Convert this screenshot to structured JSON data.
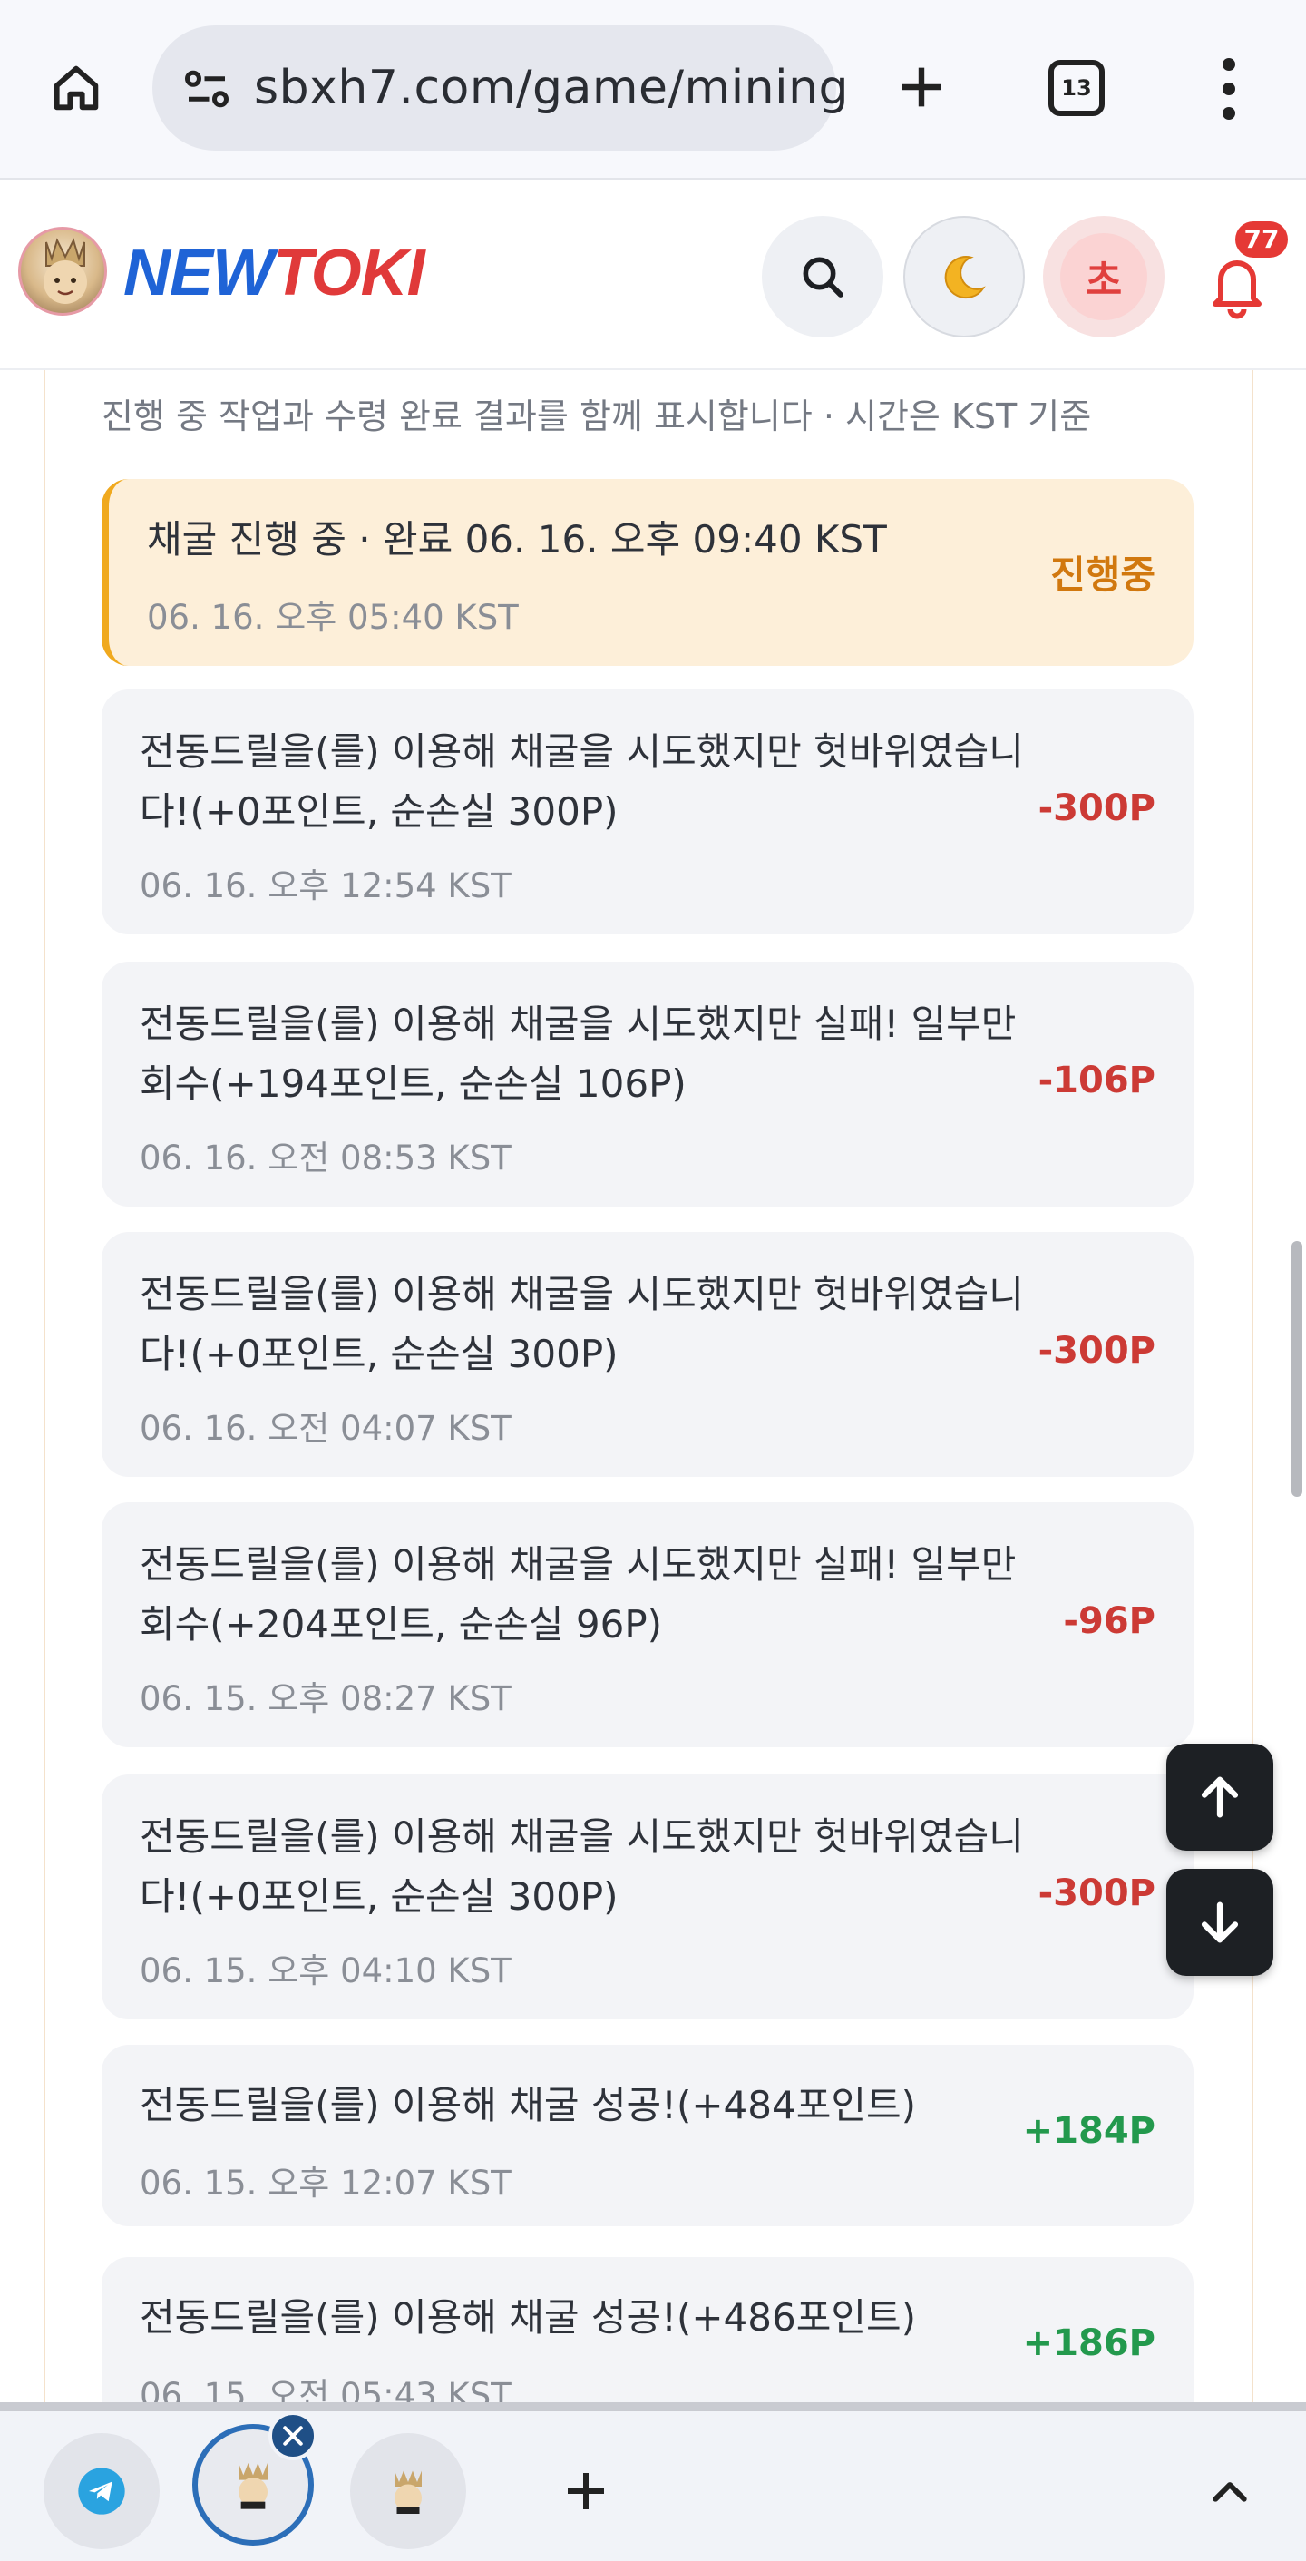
{
  "browser": {
    "url": "sbxh7.com/game/mining",
    "tab_count": "13",
    "icons": [
      "home-icon",
      "site-settings-icon",
      "plus-icon",
      "tabs-icon",
      "more-vert-icon"
    ]
  },
  "header": {
    "logo_new": "NEW",
    "logo_toki": "TOKI",
    "user_initial": "초",
    "notification_count": "77",
    "theme_icon": "moon-icon"
  },
  "content": {
    "subtitle": "진행 중 작업과 수령 완료 결과를 함께 표시합니다 · 시간은 KST 기준",
    "in_progress": {
      "text": "채굴 진행 중 · 완료 06. 16. 오후 09:40 KST",
      "time": "06. 16. 오후 05:40 KST",
      "status": "진행중"
    },
    "items": [
      {
        "text": "전동드릴을(를) 이용해 채굴을 시도했지만 헛바위였습니다!(+0포인트, 순손실 300P)",
        "time": "06. 16. 오후 12:54 KST",
        "amount": "-300P"
      },
      {
        "text": "전동드릴을(를) 이용해 채굴을 시도했지만 실패! 일부만 회수(+194포인트, 순손실 106P)",
        "time": "06. 16. 오전 08:53 KST",
        "amount": "-106P"
      },
      {
        "text": "전동드릴을(를) 이용해 채굴을 시도했지만 헛바위였습니다!(+0포인트, 순손실 300P)",
        "time": "06. 16. 오전 04:07 KST",
        "amount": "-300P"
      },
      {
        "text": "전동드릴을(를) 이용해 채굴을 시도했지만 실패! 일부만 회수(+204포인트, 순손실 96P)",
        "time": "06. 15. 오후 08:27 KST",
        "amount": "-96P"
      },
      {
        "text": "전동드릴을(를) 이용해 채굴을 시도했지만 헛바위였습니다!(+0포인트, 순손실 300P)",
        "time": "06. 15. 오후 04:10 KST",
        "amount": "-300P"
      },
      {
        "text": "전동드릴을(를) 이용해 채굴 성공!(+484포인트)",
        "time": "06. 15. 오후 12:07 KST",
        "amount": "+184P"
      },
      {
        "text": "전동드릴을(를) 이용해 채굴 성공!(+486포인트)",
        "time": "06. 15. 오전 05:43 KST",
        "amount": "+186P"
      }
    ]
  },
  "colors": {
    "negative": "#cc3a35",
    "positive": "#23994d",
    "progress_accent": "#f0a91e",
    "progress_status": "#d1780f",
    "logo_blue": "#1f63d6",
    "logo_red": "#e03a3a"
  }
}
